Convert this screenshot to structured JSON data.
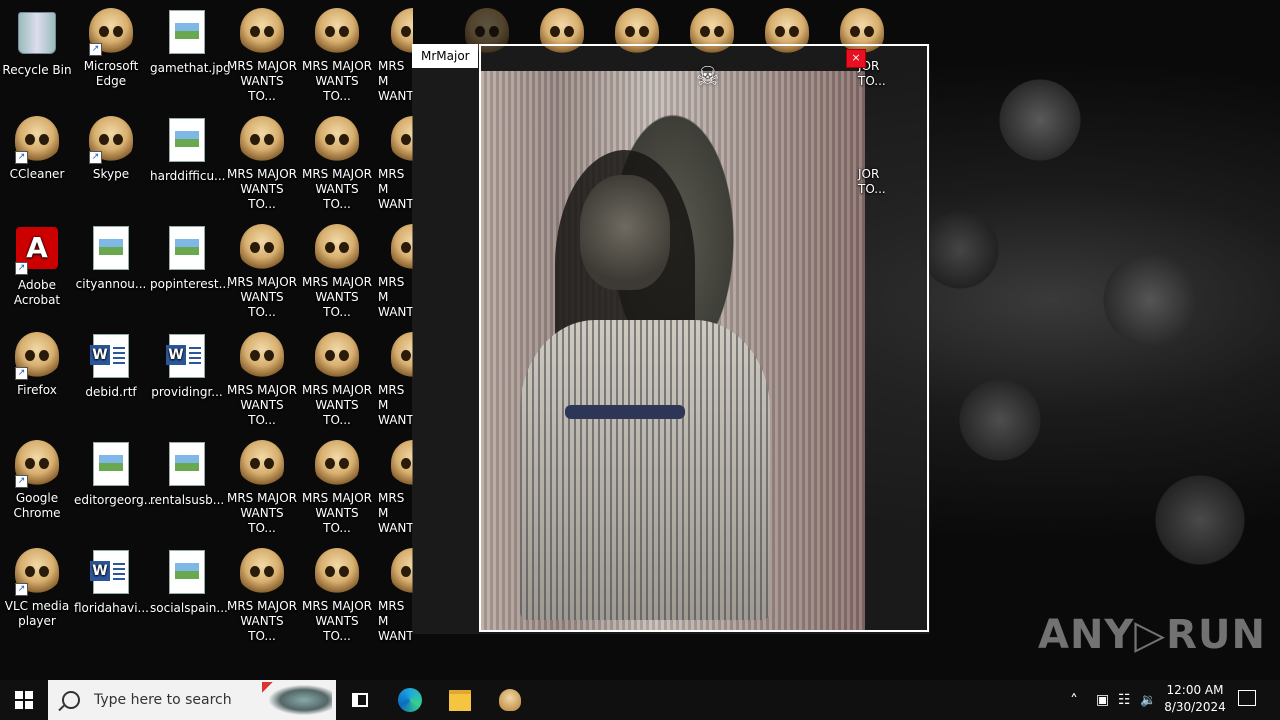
{
  "desktop": {
    "icons": [
      {
        "label": "Recycle Bin",
        "type": "recycle"
      },
      {
        "label": "Microsoft Edge",
        "type": "skull"
      },
      {
        "label": "gamethat.jpg",
        "type": "image"
      },
      {
        "label": "MRS MAJOR WANTS TO...",
        "type": "skull"
      },
      {
        "label": "MRS MAJOR WANTS TO...",
        "type": "skull"
      },
      {
        "label": "CCleaner",
        "type": "skull"
      },
      {
        "label": "Skype",
        "type": "skull"
      },
      {
        "label": "harddifficu...",
        "type": "image"
      },
      {
        "label": "Adobe Acrobat",
        "type": "acrobat"
      },
      {
        "label": "cityannou...",
        "type": "image"
      },
      {
        "label": "popinterest...",
        "type": "image"
      },
      {
        "label": "Firefox",
        "type": "skull"
      },
      {
        "label": "debid.rtf",
        "type": "word"
      },
      {
        "label": "providingr...",
        "type": "word"
      },
      {
        "label": "Google Chrome",
        "type": "skull"
      },
      {
        "label": "editorgeorg...",
        "type": "image"
      },
      {
        "label": "rentalsusb...",
        "type": "image"
      },
      {
        "label": "VLC media player",
        "type": "skull"
      },
      {
        "label": "floridahavi...",
        "type": "word"
      },
      {
        "label": "socialspain...",
        "type": "image"
      }
    ],
    "skull_label": "MRS MAJOR WANTS TO...",
    "skull_label_short": "MRS M WANT",
    "skull_label_right": "JOR TO..."
  },
  "window": {
    "title": "MrMajor",
    "close_glyph": "×",
    "crossbones_glyph": "☠"
  },
  "watermark": "ANY▷RUN",
  "taskbar": {
    "search_placeholder": "Type here to search",
    "time": "12:00 AM",
    "date": "8/30/2024",
    "tray_up": "˄",
    "tray_icons": [
      "▣",
      "☷",
      "🔉"
    ]
  }
}
